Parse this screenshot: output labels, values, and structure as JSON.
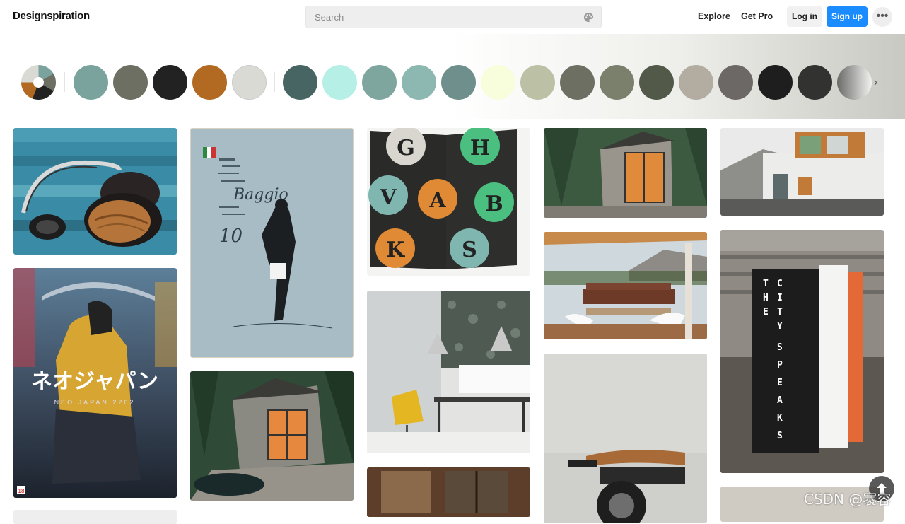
{
  "brand": {
    "name": "Designspiration"
  },
  "search": {
    "placeholder": "Search"
  },
  "nav": {
    "explore": "Explore",
    "get_pro": "Get Pro",
    "login": "Log in",
    "signup": "Sign up"
  },
  "palette": {
    "selected": [
      "#7aa39e",
      "#6d6f62",
      "#222222",
      "#b26a22",
      "#dadad4"
    ],
    "suggested": [
      "#476663",
      "#b6efe6",
      "#7ea69f",
      "#8db7b1",
      "#6e8f8b",
      "#f8fddc",
      "#bcc1a6",
      "#6c6f62",
      "#7b806d",
      "#535948",
      "#b2aca1",
      "#6b6866",
      "#1e1e1e",
      "#323230",
      "#6a6a68"
    ]
  },
  "images": {
    "col1": [
      "headphones-on-blue-wood",
      "neo-japan-poster",
      "image-bottom-left"
    ],
    "col2": [
      "baggio-poster",
      "forest-cabin"
    ],
    "col3": [
      "typography-book-spread",
      "yellow-chair-interior",
      "cabin-window"
    ],
    "col4": [
      "house-in-forest",
      "patio-lounge",
      "motorcycle"
    ],
    "col5": [
      "container-house",
      "the-city-speaks-sign",
      "image-bottom-right"
    ]
  },
  "poster": {
    "title": "ネオジャパン",
    "subtitle": "NEO JAPAN 2202",
    "rating": "18"
  },
  "baggio": {
    "name": "Baggio",
    "number": "10"
  },
  "typo_book": {
    "letters": [
      "G",
      "H",
      "V",
      "A",
      "B",
      "K",
      "S"
    ]
  },
  "sign": {
    "letters": [
      "T",
      "H",
      "E",
      "C",
      "I",
      "T",
      "Y",
      "S",
      "P",
      "E",
      "A",
      "K",
      "S"
    ]
  },
  "watermark": "CSDN @褰容"
}
